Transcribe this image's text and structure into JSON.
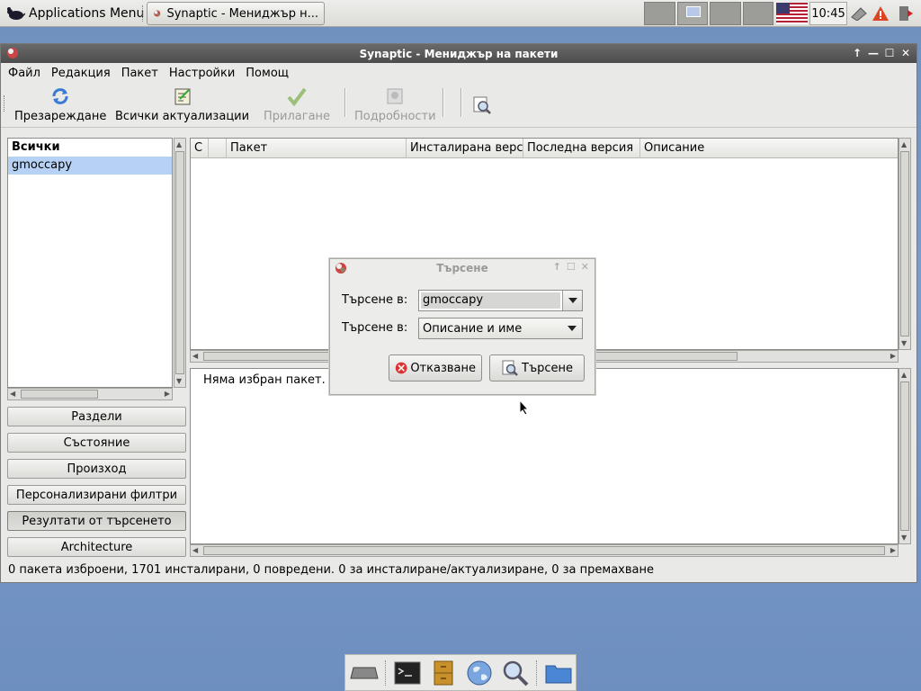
{
  "panel": {
    "app_menu_label": "Applications Menu",
    "task_label": "Synaptic - Мениджър н...",
    "clock": "10:45"
  },
  "window": {
    "title": "Synaptic - Мениджър на пакети",
    "menu": [
      "Файл",
      "Редакция",
      "Пакет",
      "Настройки",
      "Помощ"
    ],
    "toolbar": {
      "reload": "Презареждане",
      "upgrade_all": "Всички актуализации",
      "apply": "Прилагане",
      "properties": "Подробности"
    },
    "filter_list": {
      "header": "Всички",
      "items": [
        "gmoccapy"
      ]
    },
    "filter_buttons": [
      "Раздели",
      "Състояние",
      "Произход",
      "Персонализирани филтри",
      "Резултати от търсенето",
      "Architecture"
    ],
    "columns": [
      "С",
      "",
      "Пакет",
      "Инсталирана версия",
      "Последна версия",
      "Описание"
    ],
    "description_text": "Няма избран пакет.",
    "status_text": "0 пакета изброени, 1701 инсталирани, 0 повредени. 0 за инсталиране/актуализиране, 0 за премахване"
  },
  "dialog": {
    "title": "Търсене",
    "search_label": "Търсене в:",
    "search_value": "gmoccapy",
    "field_label": "Търсене в:",
    "field_value": "Описание и име",
    "cancel_label": "Отказване",
    "search_button_label": "Търсене"
  },
  "colors": {
    "desktop": "#7d9cc9",
    "selection": "#b6d1f3",
    "titlebar": "#545454"
  }
}
